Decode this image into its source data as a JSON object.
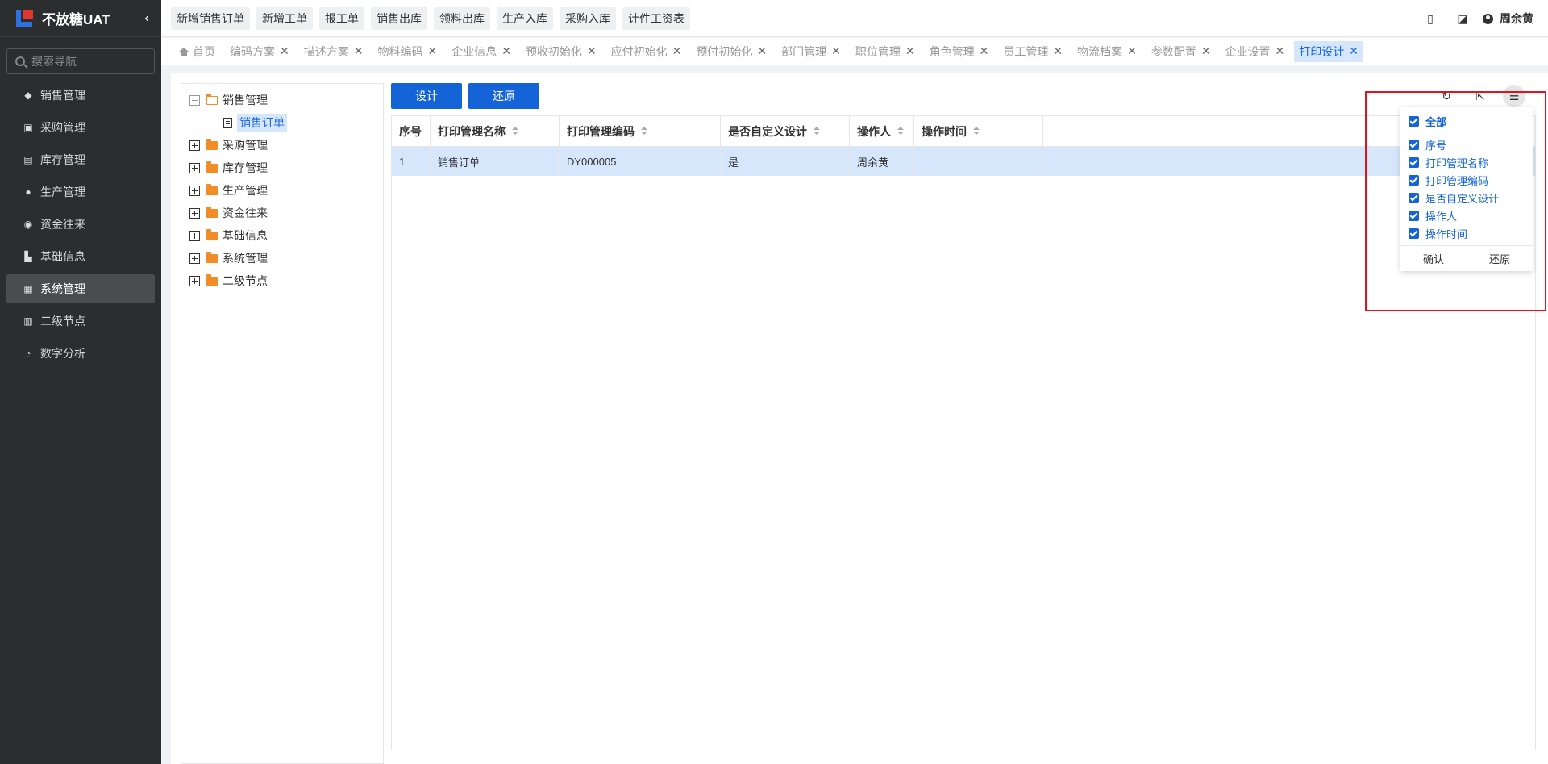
{
  "app": {
    "brand": "不放糖UAT"
  },
  "sidebar": {
    "search_placeholder": "搜索导航",
    "items": [
      {
        "label": "销售管理",
        "icon": "tag-icon"
      },
      {
        "label": "采购管理",
        "icon": "cart-icon"
      },
      {
        "label": "库存管理",
        "icon": "warehouse-icon"
      },
      {
        "label": "生产管理",
        "icon": "production-icon"
      },
      {
        "label": "资金往来",
        "icon": "money-icon"
      },
      {
        "label": "基础信息",
        "icon": "info-icon"
      },
      {
        "label": "系统管理",
        "icon": "system-icon"
      },
      {
        "label": "二级节点",
        "icon": "node-icon"
      },
      {
        "label": "数字分析",
        "icon": "pie-chart-icon"
      }
    ],
    "active_index": 6
  },
  "quick_actions": [
    "新增销售订单",
    "新增工单",
    "报工单",
    "销售出库",
    "领料出库",
    "生产入库",
    "采购入库",
    "计件工资表"
  ],
  "user": {
    "name": "周余黄"
  },
  "tabs": [
    {
      "label": "首页"
    },
    {
      "label": "编码方案"
    },
    {
      "label": "描述方案"
    },
    {
      "label": "物料编码"
    },
    {
      "label": "企业信息"
    },
    {
      "label": "预收初始化"
    },
    {
      "label": "应付初始化"
    },
    {
      "label": "预付初始化"
    },
    {
      "label": "部门管理"
    },
    {
      "label": "职位管理"
    },
    {
      "label": "角色管理"
    },
    {
      "label": "员工管理"
    },
    {
      "label": "物流档案"
    },
    {
      "label": "参数配置"
    },
    {
      "label": "企业设置"
    },
    {
      "label": "打印设计"
    }
  ],
  "tree": {
    "root": "销售管理",
    "selected_child": "销售订单",
    "others": [
      "采购管理",
      "库存管理",
      "生产管理",
      "资金往来",
      "基础信息",
      "系统管理",
      "二级节点"
    ]
  },
  "toolbar": {
    "design": "设计",
    "restore": "还原"
  },
  "table": {
    "columns": [
      "序号",
      "打印管理名称",
      "打印管理编码",
      "是否自定义设计",
      "操作人",
      "操作时间"
    ],
    "rows": [
      [
        "1",
        "销售订单",
        "DY000005",
        "是",
        "周余黄",
        ""
      ]
    ]
  },
  "column_menu": {
    "all": "全部",
    "items": [
      "序号",
      "打印管理名称",
      "打印管理编码",
      "是否自定义设计",
      "操作人",
      "操作时间"
    ],
    "confirm": "确认",
    "restore": "还原"
  },
  "colors": {
    "accent": "#1464d8",
    "highlight": "#e0141e",
    "sidebar_bg": "#2b2d2f"
  }
}
